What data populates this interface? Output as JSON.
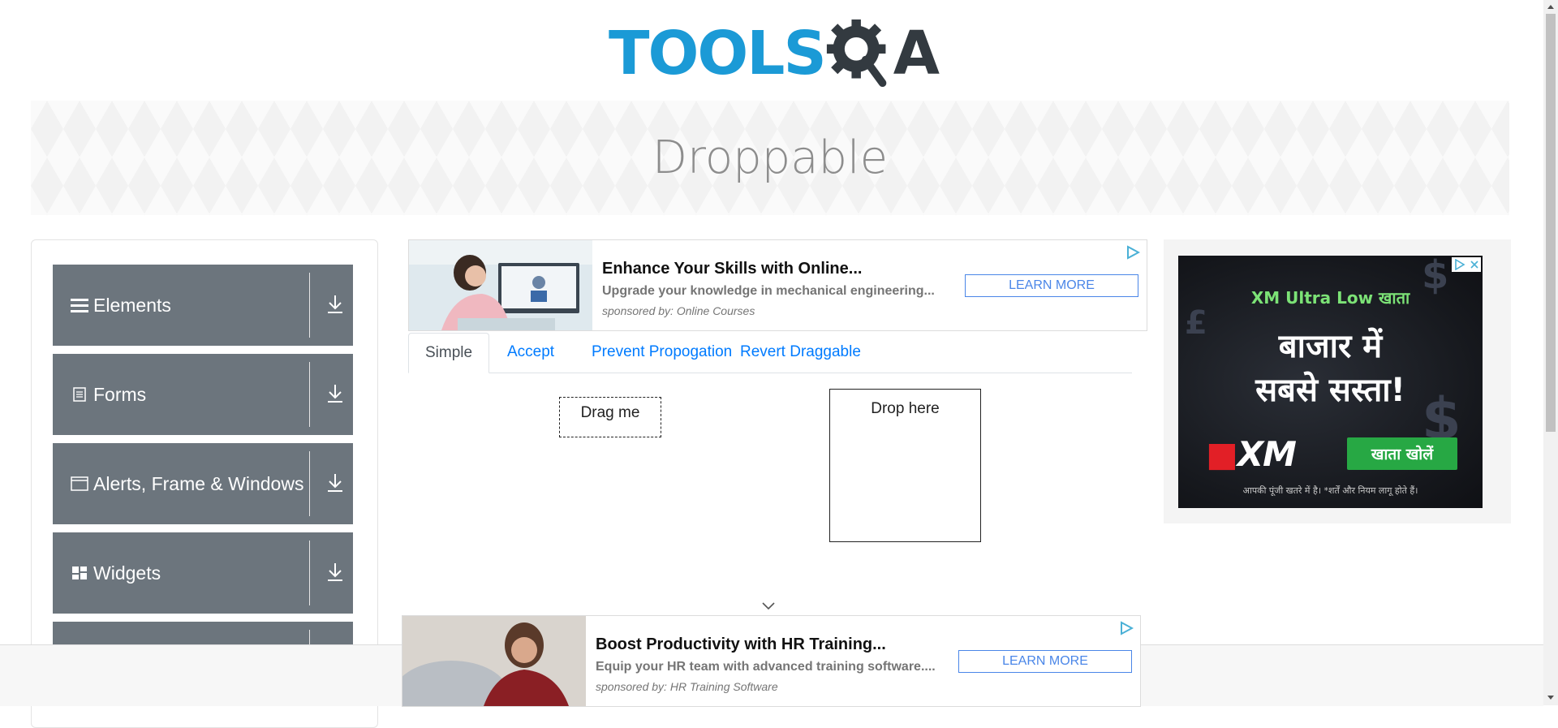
{
  "header": {
    "logo_text_tools": "TOOLS",
    "logo_text_a": "A"
  },
  "banner": {
    "title": "Droppable"
  },
  "sidebar": {
    "groups": [
      {
        "label": "Elements",
        "icon": "hamburger-icon"
      },
      {
        "label": "Forms",
        "icon": "document-icon"
      },
      {
        "label": "Alerts, Frame & Windows",
        "icon": "window-icon"
      },
      {
        "label": "Widgets",
        "icon": "widgets-icon"
      }
    ]
  },
  "ad_top": {
    "title": "Enhance Your Skills with Online...",
    "desc": "Upgrade your knowledge in mechanical engineering...",
    "sponsor": "sponsored by: Online Courses",
    "cta": "LEARN MORE"
  },
  "tabs": [
    "Simple",
    "Accept",
    "Prevent Propogation",
    "Revert Draggable"
  ],
  "draggable": {
    "label": "Drag me"
  },
  "droppable": {
    "label": "Drop here"
  },
  "ad_bottom": {
    "title": "Boost Productivity with HR Training...",
    "desc": "Equip your HR team with advanced training software....",
    "sponsor": "sponsored by: HR Training Software",
    "cta": "LEARN MORE"
  },
  "ad_right": {
    "top_line": "XM Ultra Low खाता",
    "line1": "बाजार में",
    "line2": "सबसे सस्ता!",
    "brand": "XM",
    "cta": "खाता खोलें",
    "disclaimer": "आपकी पूंजी खतरे में है। *शर्तें और नियम लागू होते हैं।"
  },
  "colors": {
    "brand_blue": "#1b9ad6",
    "sidebar_gray": "#6c757d",
    "link_blue": "#007bff"
  }
}
